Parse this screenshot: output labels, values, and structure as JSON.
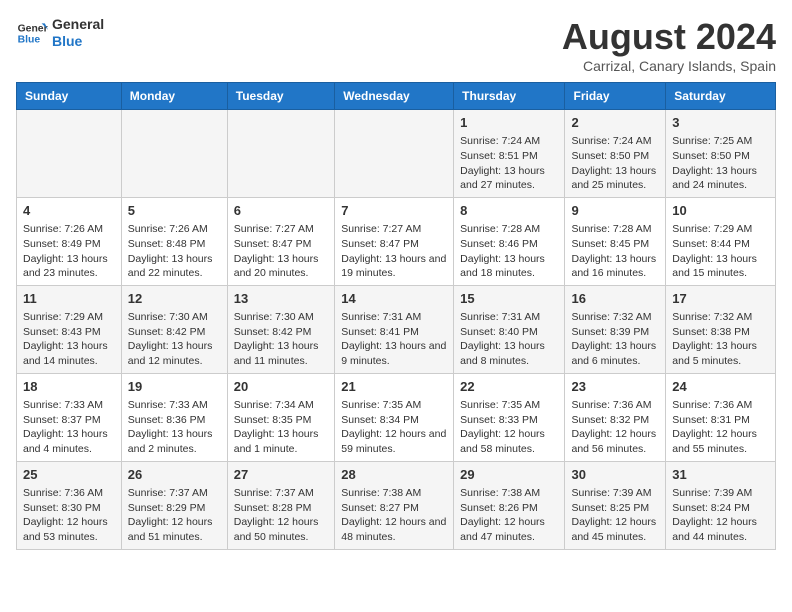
{
  "logo": {
    "text_general": "General",
    "text_blue": "Blue"
  },
  "title": "August 2024",
  "subtitle": "Carrizal, Canary Islands, Spain",
  "days_of_week": [
    "Sunday",
    "Monday",
    "Tuesday",
    "Wednesday",
    "Thursday",
    "Friday",
    "Saturday"
  ],
  "weeks": [
    [
      {
        "day": "",
        "info": ""
      },
      {
        "day": "",
        "info": ""
      },
      {
        "day": "",
        "info": ""
      },
      {
        "day": "",
        "info": ""
      },
      {
        "day": "1",
        "info": "Sunrise: 7:24 AM\nSunset: 8:51 PM\nDaylight: 13 hours and 27 minutes."
      },
      {
        "day": "2",
        "info": "Sunrise: 7:24 AM\nSunset: 8:50 PM\nDaylight: 13 hours and 25 minutes."
      },
      {
        "day": "3",
        "info": "Sunrise: 7:25 AM\nSunset: 8:50 PM\nDaylight: 13 hours and 24 minutes."
      }
    ],
    [
      {
        "day": "4",
        "info": "Sunrise: 7:26 AM\nSunset: 8:49 PM\nDaylight: 13 hours and 23 minutes."
      },
      {
        "day": "5",
        "info": "Sunrise: 7:26 AM\nSunset: 8:48 PM\nDaylight: 13 hours and 22 minutes."
      },
      {
        "day": "6",
        "info": "Sunrise: 7:27 AM\nSunset: 8:47 PM\nDaylight: 13 hours and 20 minutes."
      },
      {
        "day": "7",
        "info": "Sunrise: 7:27 AM\nSunset: 8:47 PM\nDaylight: 13 hours and 19 minutes."
      },
      {
        "day": "8",
        "info": "Sunrise: 7:28 AM\nSunset: 8:46 PM\nDaylight: 13 hours and 18 minutes."
      },
      {
        "day": "9",
        "info": "Sunrise: 7:28 AM\nSunset: 8:45 PM\nDaylight: 13 hours and 16 minutes."
      },
      {
        "day": "10",
        "info": "Sunrise: 7:29 AM\nSunset: 8:44 PM\nDaylight: 13 hours and 15 minutes."
      }
    ],
    [
      {
        "day": "11",
        "info": "Sunrise: 7:29 AM\nSunset: 8:43 PM\nDaylight: 13 hours and 14 minutes."
      },
      {
        "day": "12",
        "info": "Sunrise: 7:30 AM\nSunset: 8:42 PM\nDaylight: 13 hours and 12 minutes."
      },
      {
        "day": "13",
        "info": "Sunrise: 7:30 AM\nSunset: 8:42 PM\nDaylight: 13 hours and 11 minutes."
      },
      {
        "day": "14",
        "info": "Sunrise: 7:31 AM\nSunset: 8:41 PM\nDaylight: 13 hours and 9 minutes."
      },
      {
        "day": "15",
        "info": "Sunrise: 7:31 AM\nSunset: 8:40 PM\nDaylight: 13 hours and 8 minutes."
      },
      {
        "day": "16",
        "info": "Sunrise: 7:32 AM\nSunset: 8:39 PM\nDaylight: 13 hours and 6 minutes."
      },
      {
        "day": "17",
        "info": "Sunrise: 7:32 AM\nSunset: 8:38 PM\nDaylight: 13 hours and 5 minutes."
      }
    ],
    [
      {
        "day": "18",
        "info": "Sunrise: 7:33 AM\nSunset: 8:37 PM\nDaylight: 13 hours and 4 minutes."
      },
      {
        "day": "19",
        "info": "Sunrise: 7:33 AM\nSunset: 8:36 PM\nDaylight: 13 hours and 2 minutes."
      },
      {
        "day": "20",
        "info": "Sunrise: 7:34 AM\nSunset: 8:35 PM\nDaylight: 13 hours and 1 minute."
      },
      {
        "day": "21",
        "info": "Sunrise: 7:35 AM\nSunset: 8:34 PM\nDaylight: 12 hours and 59 minutes."
      },
      {
        "day": "22",
        "info": "Sunrise: 7:35 AM\nSunset: 8:33 PM\nDaylight: 12 hours and 58 minutes."
      },
      {
        "day": "23",
        "info": "Sunrise: 7:36 AM\nSunset: 8:32 PM\nDaylight: 12 hours and 56 minutes."
      },
      {
        "day": "24",
        "info": "Sunrise: 7:36 AM\nSunset: 8:31 PM\nDaylight: 12 hours and 55 minutes."
      }
    ],
    [
      {
        "day": "25",
        "info": "Sunrise: 7:36 AM\nSunset: 8:30 PM\nDaylight: 12 hours and 53 minutes."
      },
      {
        "day": "26",
        "info": "Sunrise: 7:37 AM\nSunset: 8:29 PM\nDaylight: 12 hours and 51 minutes."
      },
      {
        "day": "27",
        "info": "Sunrise: 7:37 AM\nSunset: 8:28 PM\nDaylight: 12 hours and 50 minutes."
      },
      {
        "day": "28",
        "info": "Sunrise: 7:38 AM\nSunset: 8:27 PM\nDaylight: 12 hours and 48 minutes."
      },
      {
        "day": "29",
        "info": "Sunrise: 7:38 AM\nSunset: 8:26 PM\nDaylight: 12 hours and 47 minutes."
      },
      {
        "day": "30",
        "info": "Sunrise: 7:39 AM\nSunset: 8:25 PM\nDaylight: 12 hours and 45 minutes."
      },
      {
        "day": "31",
        "info": "Sunrise: 7:39 AM\nSunset: 8:24 PM\nDaylight: 12 hours and 44 minutes."
      }
    ]
  ]
}
